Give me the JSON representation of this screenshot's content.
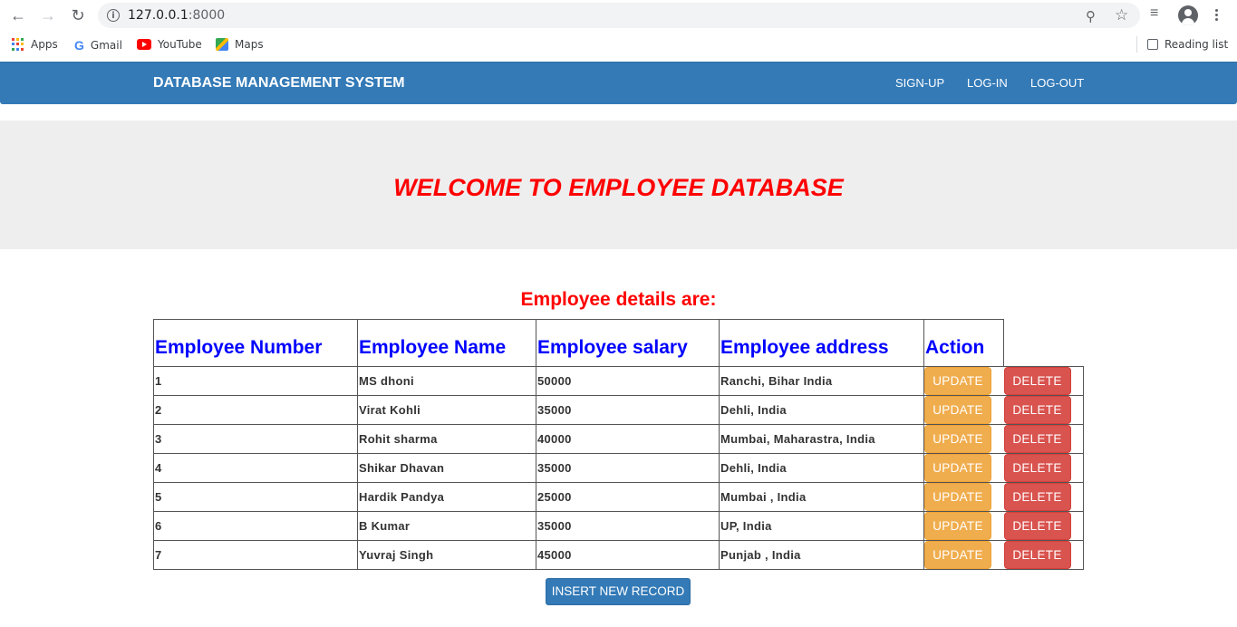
{
  "browser": {
    "url_host": "127.0.0.1",
    "url_port": ":8000",
    "bookmarks": [
      {
        "label": "Apps",
        "icon": "apps-grid-icon"
      },
      {
        "label": "Gmail",
        "icon": "google-icon"
      },
      {
        "label": "YouTube",
        "icon": "youtube-icon"
      },
      {
        "label": "Maps",
        "icon": "maps-icon"
      }
    ],
    "reading_list": "Reading list"
  },
  "navbar": {
    "brand": "DATABASE MANAGEMENT SYSTEM",
    "links": [
      "SIGN-UP",
      "LOG-IN",
      "LOG-OUT"
    ]
  },
  "jumbotron": {
    "title": "WELCOME TO EMPLOYEE DATABASE"
  },
  "details": {
    "heading": "Employee details are:",
    "columns": [
      "Employee Number",
      "Employee Name",
      "Employee salary",
      "Employee address",
      "Action"
    ],
    "rows": [
      [
        "1",
        "MS dhoni",
        "50000",
        "Ranchi, Bihar India"
      ],
      [
        "2",
        "Virat Kohli",
        "35000",
        "Dehli, India"
      ],
      [
        "3",
        "Rohit sharma",
        "40000",
        "Mumbai, Maharastra, India"
      ],
      [
        "4",
        "Shikar Dhavan",
        "35000",
        "Dehli, India"
      ],
      [
        "5",
        "Hardik Pandya",
        "25000",
        "Mumbai , India"
      ],
      [
        "6",
        "B Kumar",
        "35000",
        "UP, India"
      ],
      [
        "7",
        "Yuvraj Singh",
        "45000",
        "Punjab , India"
      ]
    ],
    "update_label": "UPDATE",
    "delete_label": "DELETE",
    "insert_label": "INSERT NEW RECORD"
  },
  "colors": {
    "primary": "#337ab7",
    "warning": "#f0ad4e",
    "danger": "#d9534f",
    "heading_red": "#ff0000",
    "column_blue": "#0000ff"
  }
}
